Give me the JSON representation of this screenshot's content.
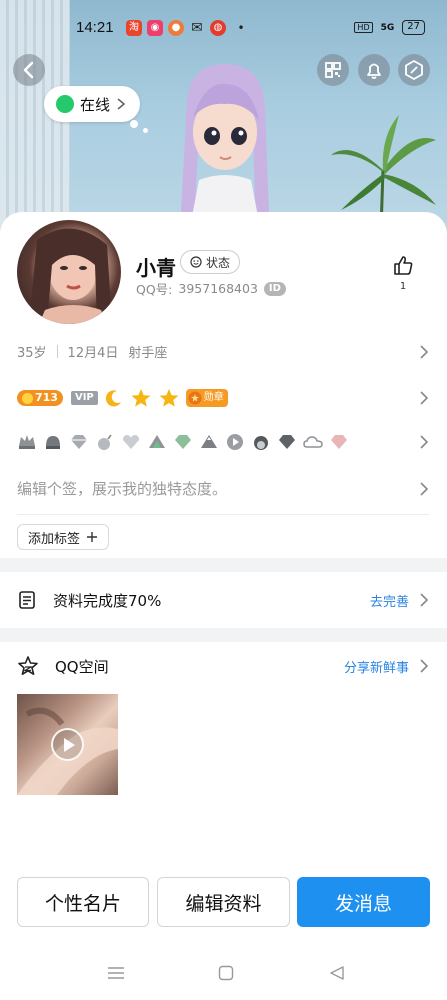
{
  "status_bar": {
    "time": "14:21",
    "hd_label": "HD",
    "network_label": "5G",
    "battery": "27"
  },
  "header": {
    "online_status": "在线"
  },
  "profile": {
    "nickname": "小青",
    "status_label": "状态",
    "qq_prefix": "QQ号:",
    "qq_number": "3957168403",
    "id_badge": "ID",
    "like_count": "1",
    "age": "35岁",
    "birthday": "12月4日",
    "zodiac": "射手座",
    "level": "713",
    "vip_label": "VIP",
    "medal_label": "勋章",
    "signature_placeholder": "编辑个签，展示我的独特态度。",
    "add_tag_label": "添加标签"
  },
  "completion": {
    "label": "资料完成度70%",
    "action": "去完善"
  },
  "qzone": {
    "label": "QQ空间",
    "action": "分享新鲜事"
  },
  "actions": {
    "card_button": "个性名片",
    "edit_button": "编辑资料",
    "message_button": "发消息"
  },
  "colors": {
    "accent_blue": "#1e90f0",
    "link_blue": "#2a84e0",
    "online_green": "#25c96b",
    "level_orange": "#f29121"
  }
}
